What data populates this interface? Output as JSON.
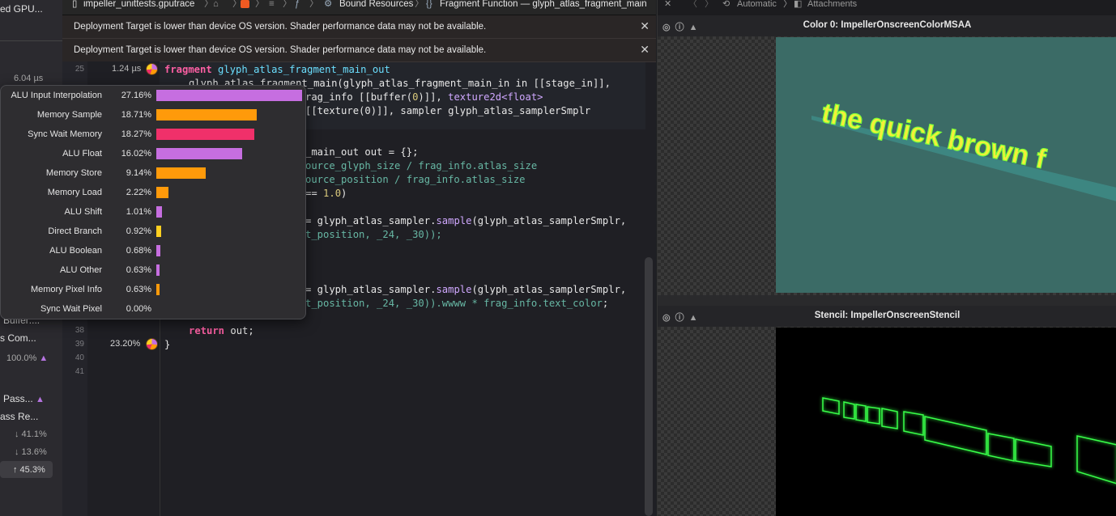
{
  "sidebar": {
    "title_fragment": "ed GPU...",
    "time_value": "6.04 µs",
    "items": [
      {
        "label": "Buffer:..."
      },
      {
        "label": "s Com..."
      },
      {
        "label": "100.0%"
      },
      {
        "label": "Pass..."
      },
      {
        "label": "ass Re..."
      },
      {
        "label": "↓ 41.1%"
      },
      {
        "label": "↓ 13.6%"
      },
      {
        "label": "↑ 45.3%"
      }
    ]
  },
  "jumpbar": {
    "file": "impeller_unittests.gputrace",
    "bound_resources": "Bound Resources",
    "fragment_function": "Fragment Function — glyph_atlas_fragment_main"
  },
  "banners": [
    {
      "text": "Deployment Target is lower than device OS version. Shader performance data may not be available."
    },
    {
      "text": "Deployment Target is lower than device OS version. Shader performance data may not be available."
    }
  ],
  "perf": {
    "line25_time": "1.24 µs",
    "line39_pct": "23.20%"
  },
  "line_numbers": [
    "25",
    "38",
    "39",
    "40",
    "41"
  ],
  "popover": {
    "rows": [
      {
        "label": "ALU Input Interpolation",
        "pct": "27.16%",
        "value": 27.16,
        "color": "#c66ee0"
      },
      {
        "label": "Memory Sample",
        "pct": "18.71%",
        "value": 18.71,
        "color": "#ff9a0a"
      },
      {
        "label": "Sync Wait Memory",
        "pct": "18.27%",
        "value": 18.27,
        "color": "#f0306a"
      },
      {
        "label": "ALU Float",
        "pct": "16.02%",
        "value": 16.02,
        "color": "#c66ee0"
      },
      {
        "label": "Memory Store",
        "pct": "9.14%",
        "value": 9.14,
        "color": "#ff9a0a"
      },
      {
        "label": "Memory Load",
        "pct": "2.22%",
        "value": 2.22,
        "color": "#ff9a0a"
      },
      {
        "label": "ALU Shift",
        "pct": "1.01%",
        "value": 1.01,
        "color": "#c66ee0"
      },
      {
        "label": "Direct Branch",
        "pct": "0.92%",
        "value": 0.92,
        "color": "#ffcf20"
      },
      {
        "label": "ALU Boolean",
        "pct": "0.68%",
        "value": 0.68,
        "color": "#c66ee0"
      },
      {
        "label": "ALU Other",
        "pct": "0.63%",
        "value": 0.63,
        "color": "#c66ee0"
      },
      {
        "label": "Memory Pixel Info",
        "pct": "0.63%",
        "value": 0.63,
        "color": "#ff9a0a"
      },
      {
        "label": "Sync Wait Pixel",
        "pct": "0.00%",
        "value": 0.0,
        "color": "#f0306a"
      }
    ]
  },
  "code": {
    "l25_kw": "fragment",
    "l25_name": "glyph_atlas_fragment_main_out",
    "l26": "glyph_atlas_fragment_main(glyph_atlas_fragment_main_in in [[stage_in]],",
    "l27a": "rag_info [[buffer(",
    "l27b": ")]], ",
    "l27c": "texture2d<float>",
    "l28": "[[texture(0)]], sampler glyph_atlas_samplerSmplr",
    "l30": "_main_out out = {};",
    "l31a": "ource_glyph_size / frag_info.",
    "l31b": "atlas_size",
    "l32a": "ource_position / frag_info.",
    "l32b": "atlas_size",
    "l33a": "== ",
    "l33b": "1.0",
    "l35a": "= glyph_atlas_sampler.",
    "l35b": "sample",
    "l35c": "(glyph_atlas_samplerSmplr,",
    "l36": "t_position, _24, _30));",
    "l39a": "= glyph_atlas_sampler.",
    "l39b": "sample",
    "l39c": "(glyph_atlas_samplerSmplr,",
    "l40a": "t_position, _24, _30)).wwww * frag_info.",
    "l40b": "text_color",
    "l40c": ";",
    "ret_kw": "return",
    "ret_rest": " out;",
    "close": "}"
  },
  "right": {
    "jump": {
      "automatic": "Automatic",
      "attachments": "Attachments"
    },
    "color_title": "Color 0: ImpellerOnscreenColorMSAA",
    "stencil_title": "Stencil: ImpellerOnscreenStencil",
    "render_text": "the quick brown f"
  }
}
